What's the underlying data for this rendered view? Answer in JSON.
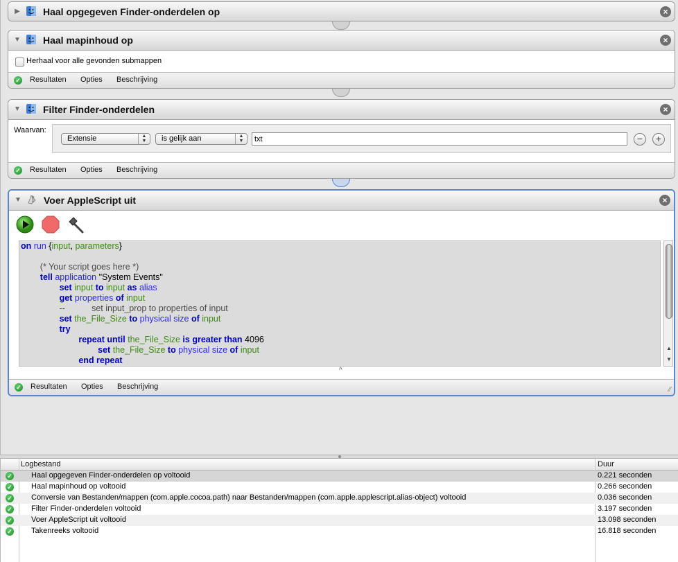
{
  "actions": [
    {
      "title": "Haal opgegeven Finder-onderdelen op",
      "state": "collapsed"
    },
    {
      "title": "Haal mapinhoud op",
      "state": "expanded",
      "checkbox_label": "Herhaal voor alle gevonden submappen",
      "footer": [
        "Resultaten",
        "Opties",
        "Beschrijving"
      ]
    },
    {
      "title": "Filter Finder-onderdelen",
      "state": "expanded",
      "where_label": "Waarvan:",
      "property_select": "Extensie",
      "operator_select": "is gelijk aan",
      "value_input": "txt",
      "footer": [
        "Resultaten",
        "Opties",
        "Beschrijving"
      ]
    },
    {
      "title": "Voer AppleScript uit",
      "state": "selected",
      "footer": [
        "Resultaten",
        "Opties",
        "Beschrijving"
      ]
    }
  ],
  "script_lines": [
    [
      [
        "kw",
        "on"
      ],
      [
        "ev",
        " run "
      ],
      [
        "t",
        "{"
      ],
      [
        "var",
        "input"
      ],
      [
        "t",
        ", "
      ],
      [
        "var",
        "parameters"
      ],
      [
        "t",
        "}"
      ]
    ],
    [],
    [
      [
        "t",
        "        "
      ],
      [
        "cm",
        "(* Your script goes here *)"
      ]
    ],
    [
      [
        "t",
        "        "
      ],
      [
        "kw",
        "tell"
      ],
      [
        "ev",
        " application "
      ],
      [
        "t",
        "\"System Events\""
      ]
    ],
    [
      [
        "t",
        "                "
      ],
      [
        "kw",
        "set"
      ],
      [
        "var",
        " input "
      ],
      [
        "kw",
        "to"
      ],
      [
        "var",
        " input "
      ],
      [
        "kw",
        "as"
      ],
      [
        "ev",
        " alias"
      ]
    ],
    [
      [
        "t",
        "                "
      ],
      [
        "kw",
        "get"
      ],
      [
        "ev",
        " properties "
      ],
      [
        "kw",
        "of"
      ],
      [
        "var",
        " input"
      ]
    ],
    [
      [
        "t",
        "                "
      ],
      [
        "cm",
        "--           set input_prop to properties of input"
      ]
    ],
    [
      [
        "t",
        "                "
      ],
      [
        "kw",
        "set"
      ],
      [
        "var",
        " the_File_Size "
      ],
      [
        "kw",
        "to"
      ],
      [
        "ev",
        " physical size "
      ],
      [
        "kw",
        "of"
      ],
      [
        "var",
        " input"
      ]
    ],
    [
      [
        "t",
        "                "
      ],
      [
        "kw",
        "try"
      ]
    ],
    [
      [
        "t",
        "                        "
      ],
      [
        "kw",
        "repeat until"
      ],
      [
        "var",
        " the_File_Size "
      ],
      [
        "kw",
        "is greater than"
      ],
      [
        "t",
        " 4096"
      ]
    ],
    [
      [
        "t",
        "                                "
      ],
      [
        "kw",
        "set"
      ],
      [
        "var",
        " the_File_Size "
      ],
      [
        "kw",
        "to"
      ],
      [
        "ev",
        " physical size "
      ],
      [
        "kw",
        "of"
      ],
      [
        "var",
        " input"
      ]
    ],
    [
      [
        "t",
        "                        "
      ],
      [
        "kw",
        "end repeat"
      ]
    ]
  ],
  "log": {
    "col_log": "Logbestand",
    "col_duration": "Duur",
    "rows": [
      {
        "message": "Haal opgegeven Finder-onderdelen op voltooid",
        "duration": "0.221 seconden"
      },
      {
        "message": "Haal mapinhoud op voltooid",
        "duration": "0.266 seconden"
      },
      {
        "message": "Conversie van Bestanden/mappen (com.apple.cocoa.path) naar Bestanden/mappen (com.apple.applescript.alias-object) voltooid",
        "duration": "0.036 seconden"
      },
      {
        "message": "Filter Finder-onderdelen voltooid",
        "duration": "3.197 seconden"
      },
      {
        "message": "Voer AppleScript uit voltooid",
        "duration": "13.098 seconden"
      },
      {
        "message": "Takenreeks voltooid",
        "duration": "16.818 seconden"
      }
    ]
  },
  "colors": {
    "accent": "#5a86d0",
    "keyword": "#0000c8",
    "variable": "#3d8a12",
    "comment": "#4b4b4b"
  },
  "icons": {
    "finder": "finder-icon",
    "applescript": "applescript-icon",
    "run": "run-icon",
    "stop": "stop-icon",
    "compile": "hammer-icon",
    "status": "checkmark-icon"
  }
}
